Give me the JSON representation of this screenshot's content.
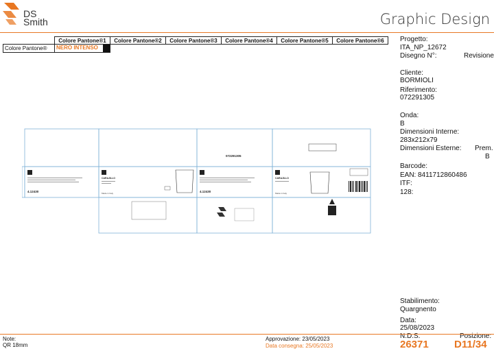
{
  "header": {
    "logo_line1": "DS",
    "logo_line2": "Smith",
    "title": "Graphic Design"
  },
  "pantone": {
    "headers": [
      "Colore Pantone®1",
      "Colore Pantone®2",
      "Colore Pantone®3",
      "Colore Pantone®4",
      "Colore Pantone®5",
      "Colore Pantone®6"
    ],
    "row_label": "Colore Pantone®",
    "color1": "NERO INTENSO",
    "swatch_color": "#111111"
  },
  "info": {
    "progetto_label": "Progetto:",
    "progetto_value": "ITA_NP_12672",
    "disegno_label": "Disegno N°:",
    "revisione_label": "Revisione:",
    "cliente_label": "Cliente:",
    "cliente_value": "BORMIOLI",
    "riferimento_label": "Riferimento:",
    "riferimento_value": "072291305",
    "onda_label": "Onda:",
    "onda_value": "B",
    "dim_interne_label": "Dimensioni Interne:",
    "dim_interne_value": "283x212x79",
    "dim_esterne_label": "Dimensioni Esterne:",
    "prem_label": "Prem.",
    "prem_value": "B",
    "barcode_label": "Barcode:",
    "ean_label": "EAN:",
    "ean_value": "8411712860486",
    "itf_label": "ITF:",
    "c128_label": "128:",
    "stabilimento_label": "Stabilimento:",
    "stabilimento_value": "Quargnento",
    "data_label": "Data:",
    "data_value": "25/08/2023",
    "nds_label": "N.D.S.",
    "nds_value": "26371",
    "posizione_label": "Posizione:",
    "posizione_value": "D11/34"
  },
  "footer": {
    "note_label": "Note:",
    "note_value": "QR 18mm",
    "approvazione": "Approvazione: 23/05/2023",
    "consegna": "Data consegna: 25/05/2023"
  },
  "artwork": {
    "ref_code": "072291305",
    "product_code": "4.12430",
    "product_name": "CARAJILLO",
    "made_in": "Made in Italy"
  },
  "colors": {
    "accent": "#e87722",
    "dieline": "#7fb2d8"
  }
}
